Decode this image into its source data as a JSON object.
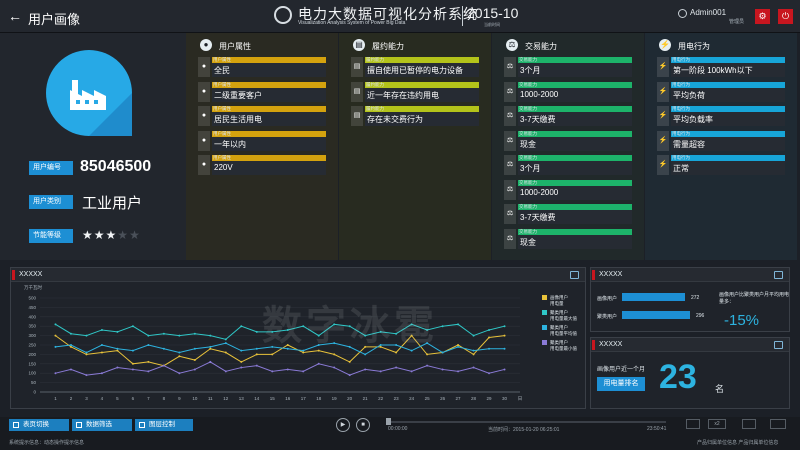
{
  "header": {
    "back_icon": "back-arrow-icon",
    "page_title": "用户画像",
    "app_title": "电力大数据可视化分析系统",
    "app_subtitle": "Visualization Analysis System of Power Big Data",
    "date": "2015-10",
    "date_caption": "当前时间",
    "user_name": "Admin001",
    "user_role": "管理员",
    "settings_icon": "gear-icon",
    "power_icon": "power-icon"
  },
  "profile": {
    "avatar_icon": "factory-icon",
    "id_label": "用户编号",
    "id_value": "85046500",
    "type_label": "用户类别",
    "type_value": "工业用户",
    "rating_label": "节能等级",
    "rating_value": 3,
    "rating_max": 5
  },
  "columns": [
    {
      "title": "用户属性",
      "icon": "user-icon",
      "color": "#d4a20e",
      "bg": "#2a2a22",
      "tags": [
        {
          "cap": "用户属性",
          "val": "全民"
        },
        {
          "cap": "用户属性",
          "val": "二级重要客户"
        },
        {
          "cap": "用户属性",
          "val": "居民生活用电"
        },
        {
          "cap": "用户属性",
          "val": "一年以内"
        },
        {
          "cap": "用户属性",
          "val": "220V"
        }
      ]
    },
    {
      "title": "履约能力",
      "icon": "document-icon",
      "color": "#b3c31a",
      "bg": "#282b20",
      "tags": [
        {
          "cap": "履约能力",
          "val": "擅自使用已暂停的电力设备"
        },
        {
          "cap": "履约能力",
          "val": "近一年存在违约用电"
        },
        {
          "cap": "履约能力",
          "val": "存在未交费行为"
        }
      ]
    },
    {
      "title": "交易能力",
      "icon": "scale-icon",
      "color": "#1db36a",
      "bg": "#21292a",
      "tags": [
        {
          "cap": "交易能力",
          "val": "3个月"
        },
        {
          "cap": "交易能力",
          "val": "1000-2000"
        },
        {
          "cap": "交易能力",
          "val": "3-7天缴费"
        },
        {
          "cap": "交易能力",
          "val": "现金"
        },
        {
          "cap": "交易能力",
          "val": "3个月"
        },
        {
          "cap": "交易能力",
          "val": "1000-2000"
        },
        {
          "cap": "交易能力",
          "val": "3-7天缴费"
        },
        {
          "cap": "交易能力",
          "val": "现金"
        }
      ]
    },
    {
      "title": "用电行为",
      "icon": "lightning-icon",
      "color": "#17a5d8",
      "bg": "#1f2a33",
      "tags": [
        {
          "cap": "用电行为",
          "val": "第一阶段 100kWh以下"
        },
        {
          "cap": "用电行为",
          "val": "平均负荷"
        },
        {
          "cap": "用电行为",
          "val": "平均负载率"
        },
        {
          "cap": "用电行为",
          "val": "需量超容"
        },
        {
          "cap": "用电行为",
          "val": "正常"
        }
      ]
    }
  ],
  "chart_panel": {
    "title": "XXXXX"
  },
  "chart_data": {
    "type": "line",
    "ylabel": "万千瓦时",
    "ylim": [
      0,
      500
    ],
    "yticks": [
      0,
      50,
      100,
      150,
      200,
      250,
      300,
      350,
      400,
      450,
      500
    ],
    "categories": [
      "1",
      "2",
      "3",
      "4",
      "5",
      "6",
      "7",
      "8",
      "9",
      "10",
      "11",
      "12",
      "13",
      "14",
      "15",
      "16",
      "17",
      "18",
      "19",
      "20",
      "21",
      "22",
      "23",
      "24",
      "25",
      "26",
      "27",
      "28",
      "29",
      "30",
      "日"
    ],
    "series": [
      {
        "name": "画像用户用电量",
        "color": "#e8c23a",
        "values": [
          300,
          240,
          200,
          210,
          220,
          150,
          160,
          140,
          190,
          170,
          230,
          210,
          160,
          200,
          200,
          250,
          210,
          220,
          200,
          160,
          240,
          240,
          210,
          300,
          200,
          210,
          250,
          200,
          290,
          300
        ]
      },
      {
        "name": "聚类用户用电量最大值",
        "color": "#2fc7c7",
        "values": [
          360,
          310,
          300,
          330,
          320,
          350,
          300,
          310,
          300,
          310,
          300,
          280,
          350,
          320,
          320,
          330,
          350,
          300,
          360,
          350,
          300,
          320,
          310,
          360,
          330,
          350,
          360,
          300,
          330,
          350
        ]
      },
      {
        "name": "聚类用户用电量平均值",
        "color": "#2db3e0",
        "values": [
          240,
          250,
          210,
          250,
          230,
          220,
          250,
          230,
          210,
          230,
          240,
          260,
          220,
          230,
          240,
          230,
          220,
          250,
          260,
          240,
          200,
          250,
          250,
          220,
          260,
          210,
          240,
          220,
          230,
          230
        ]
      },
      {
        "name": "聚类用户用电量最小值",
        "color": "#8a7ad6",
        "values": [
          100,
          120,
          90,
          100,
          130,
          120,
          110,
          140,
          100,
          120,
          160,
          110,
          130,
          140,
          110,
          120,
          110,
          150,
          130,
          90,
          120,
          110,
          130,
          110,
          140,
          120,
          110,
          130,
          100,
          120
        ]
      }
    ]
  },
  "compare_panel": {
    "title": "XXXXX",
    "bars": [
      {
        "label": "画像用户",
        "value": 272
      },
      {
        "label": "聚类用户",
        "value": 296
      }
    ],
    "note": "画像用户比聚类用户月平均用电量多：",
    "pct": "-15%"
  },
  "rank_panel": {
    "title": "XXXXX",
    "caption": "画像用户近一个月",
    "button": "用电量排名",
    "rank": "23",
    "unit": "名"
  },
  "footer": {
    "btn_switch": "表页切换",
    "btn_filter": "数据筛选",
    "btn_layer": "图层控制",
    "play_time": "00:00:00",
    "status_time": "当前时间：2015-01-20  06:25:01",
    "end_time": "23:50:41",
    "speed": "x2",
    "status_left": "系统提示信息：动态操作提示信息",
    "status_right": "产品归属单位信息 产品归属单位信息"
  },
  "watermark": "数字冰雹"
}
